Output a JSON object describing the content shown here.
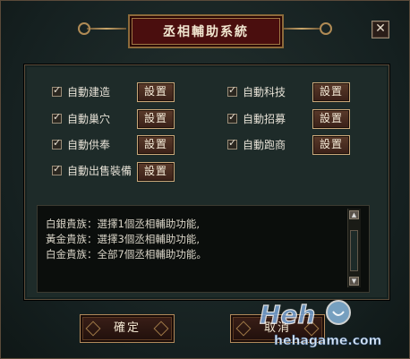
{
  "window": {
    "title": "丞相輔助系統",
    "close_glyph": "✕"
  },
  "options": [
    {
      "label": "自動建造",
      "button": "設置"
    },
    {
      "label": "自動巢穴",
      "button": "設置"
    },
    {
      "label": "自動供奉",
      "button": "設置"
    },
    {
      "label": "自動出售裝備",
      "button": "設置"
    },
    {
      "label": "自動科技",
      "button": "設置"
    },
    {
      "label": "自動招募",
      "button": "設置"
    },
    {
      "label": "自動跑商",
      "button": "設置"
    }
  ],
  "info": {
    "lines": [
      "白銀貴族：選擇1個丞相輔助功能,",
      "黃金貴族：選擇3個丞相輔助功能,",
      "白金貴族：全部7個丞相輔助功能。"
    ]
  },
  "buttons": {
    "confirm": "確定",
    "cancel": "取消"
  },
  "watermark": {
    "logo": "Heh",
    "site": "hehagame.com"
  },
  "colors": {
    "title_banner": "#4a0e0e",
    "panel": "#1e2b29",
    "gold_border": "#c9a87a"
  }
}
